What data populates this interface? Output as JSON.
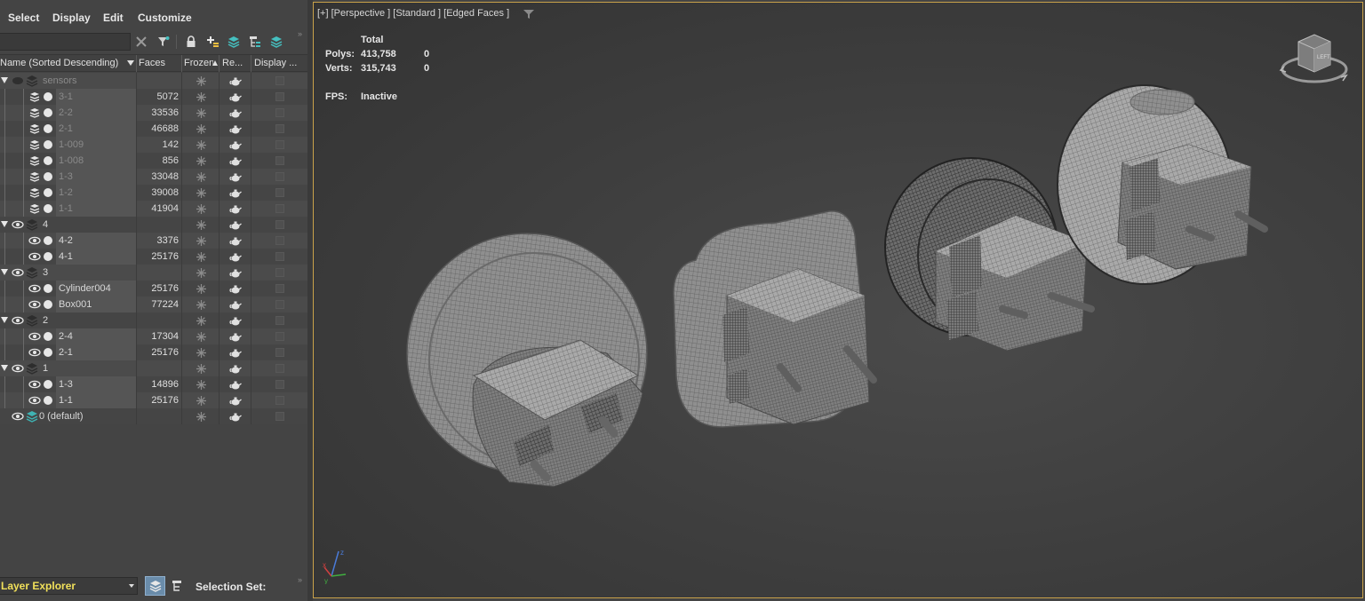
{
  "menu": {
    "items": [
      "Select",
      "Display",
      "Edit",
      "Customize"
    ]
  },
  "search": {
    "value": "",
    "placeholder": ""
  },
  "columns": {
    "name": "Name (Sorted Descending)",
    "faces": "Faces",
    "frozen": "Frozen",
    "render": "Re...",
    "display": "Display ..."
  },
  "tree": [
    {
      "label": "sensors",
      "faces": "",
      "kind": "layer",
      "hidden": true
    },
    {
      "label": "3-1",
      "faces": "5072",
      "kind": "child",
      "hidden": true
    },
    {
      "label": "2-2",
      "faces": "33536",
      "kind": "child",
      "hidden": true
    },
    {
      "label": "2-1",
      "faces": "46688",
      "kind": "child",
      "hidden": true
    },
    {
      "label": "1-009",
      "faces": "142",
      "kind": "child",
      "hidden": true
    },
    {
      "label": "1-008",
      "faces": "856",
      "kind": "child",
      "hidden": true
    },
    {
      "label": "1-3",
      "faces": "33048",
      "kind": "child",
      "hidden": true
    },
    {
      "label": "1-2",
      "faces": "39008",
      "kind": "child",
      "hidden": true
    },
    {
      "label": "1-1",
      "faces": "41904",
      "kind": "child",
      "hidden": true
    },
    {
      "label": "4",
      "faces": "",
      "kind": "layer",
      "hidden": false
    },
    {
      "label": "4-2",
      "faces": "3376",
      "kind": "child",
      "hidden": false
    },
    {
      "label": "4-1",
      "faces": "25176",
      "kind": "child",
      "hidden": false
    },
    {
      "label": "3",
      "faces": "",
      "kind": "layer",
      "hidden": false
    },
    {
      "label": "Cylinder004",
      "faces": "25176",
      "kind": "child",
      "hidden": false
    },
    {
      "label": "Box001",
      "faces": "77224",
      "kind": "child",
      "hidden": false
    },
    {
      "label": "2",
      "faces": "",
      "kind": "layer",
      "hidden": false
    },
    {
      "label": "2-4",
      "faces": "17304",
      "kind": "child",
      "hidden": false
    },
    {
      "label": "2-1",
      "faces": "25176",
      "kind": "child",
      "hidden": false
    },
    {
      "label": "1",
      "faces": "",
      "kind": "layer",
      "hidden": false
    },
    {
      "label": "1-3",
      "faces": "14896",
      "kind": "child",
      "hidden": false
    },
    {
      "label": "1-1",
      "faces": "25176",
      "kind": "child",
      "hidden": false
    },
    {
      "label": "0 (default)",
      "faces": "",
      "kind": "default",
      "hidden": false
    }
  ],
  "bottom": {
    "explorer": "Layer Explorer",
    "selection_set": "Selection Set:"
  },
  "viewport": {
    "label": "[+] [Perspective ] [Standard ] [Edged Faces ]",
    "stats": {
      "total_header": "Total",
      "polys_label": "Polys:",
      "polys_total": "413,758",
      "polys_sel": "0",
      "verts_label": "Verts:",
      "verts_total": "315,743",
      "verts_sel": "0",
      "fps_label": "FPS:",
      "fps_value": "Inactive"
    },
    "viewcube_label": "LEFT"
  },
  "colors": {
    "panel": "#444444",
    "viewport_border": "#c9a24a",
    "explorer_text": "#f1e05a",
    "layer_accent": "#3fb3b3"
  }
}
